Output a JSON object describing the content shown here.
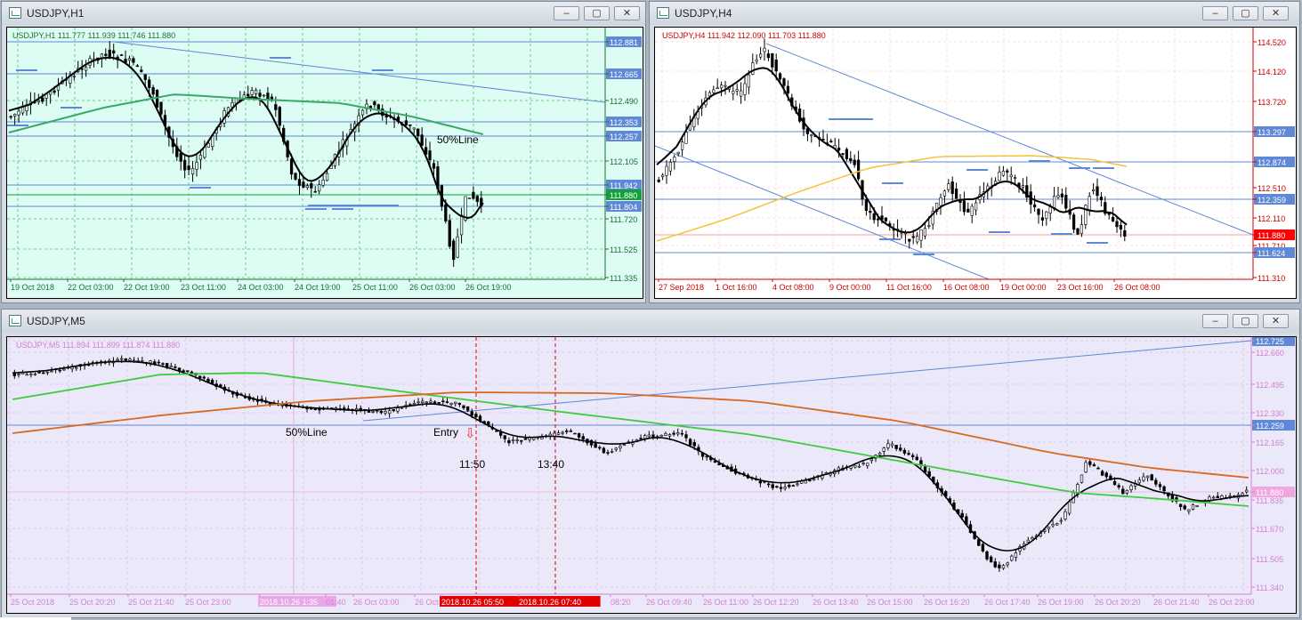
{
  "windows": {
    "h1": {
      "title": "USDJPY,H1",
      "header": "USDJPY,H1  111.777 111.939 111.746 111.880",
      "prices": [
        "112.881",
        "112.665",
        "112.490",
        "112.353",
        "112.257",
        "112.105",
        "111.942",
        "111.880",
        "111.804",
        "111.720",
        "111.525",
        "111.335"
      ],
      "price_highlight": "111.880",
      "times": [
        "19 Oct 2018",
        "22 Oct 03:00",
        "22 Oct 19:00",
        "23 Oct 11:00",
        "24 Oct 03:00",
        "24 Oct 19:00",
        "25 Oct 11:00",
        "26 Oct 03:00",
        "26 Oct 19:00"
      ],
      "label_50": "50%Line",
      "colors": {
        "bg": "#dcfcf4",
        "grid": "#57c25e",
        "bull": "#000000",
        "ma_main": "#000000",
        "ma2": "#3aa86a",
        "hline": "#5f89d6",
        "bid": "#11a13a"
      }
    },
    "h4": {
      "title": "USDJPY,H4",
      "header": "USDJPY,H4  111.942 112.090 111.703 111.880",
      "prices": [
        "114.520",
        "114.120",
        "113.720",
        "113.297",
        "112.874",
        "112.510",
        "112.359",
        "112.110",
        "111.880",
        "111.710",
        "111.624",
        "111.310"
      ],
      "price_highlight": "111.880",
      "times": [
        "27 Sep 2018",
        "1 Oct 16:00",
        "4 Oct 08:00",
        "9 Oct 00:00",
        "11 Oct 16:00",
        "16 Oct 08:00",
        "19 Oct 00:00",
        "23 Oct 16:00",
        "26 Oct 08:00"
      ],
      "colors": {
        "bg": "#ffffff",
        "grid": "#fbd4d4",
        "ma_main": "#000000",
        "ma2": "#f3c33c",
        "hline": "#5f89d6",
        "bid": "#ff0000"
      }
    },
    "m5": {
      "title": "USDJPY,M5",
      "header": "USDJPY,M5  111.894 111.899 111.874 111.880",
      "prices": [
        "112.725",
        "112.660",
        "112.495",
        "112.330",
        "112.259",
        "112.165",
        "112.000",
        "111.880",
        "111.835",
        "111.670",
        "111.505",
        "111.340"
      ],
      "price_highlight": "111.880",
      "times": [
        "25 Oct 2018",
        "25 Oct 20:20",
        "25 Oct 21:40",
        "25 Oct 23:00",
        "2018.10.26 1:35",
        "01:40",
        "26 Oct 03:00",
        "26 Oct",
        "2018.10.26 05:50",
        "2018.10.26 07:40",
        "08:20",
        "26 Oct 09:40",
        "26 Oct 11:00",
        "26 Oct 12:20",
        "26 Oct 13:40",
        "26 Oct 15:00",
        "26 Oct 16:20",
        "26 Oct 17:40",
        "26 Oct 19:00",
        "26 Oct 20:20",
        "26 Oct 21:40",
        "26 Oct 23:00"
      ],
      "label_50": "50%Line",
      "label_entry": "Entry",
      "entry_arrow": "⇩",
      "time1": "11:50",
      "time2": "13:40",
      "colors": {
        "bg": "#ebe8f9",
        "grid": "#d9c2ea",
        "ma_main": "#000000",
        "ma2": "#3dcc3d",
        "ma3": "#d96820",
        "hline": "#5f89d6",
        "vline": "#e00000",
        "bid": "#f0a6df"
      }
    }
  },
  "buttons": {
    "minimize": "‒",
    "maximize": "▢",
    "close": "✕"
  }
}
